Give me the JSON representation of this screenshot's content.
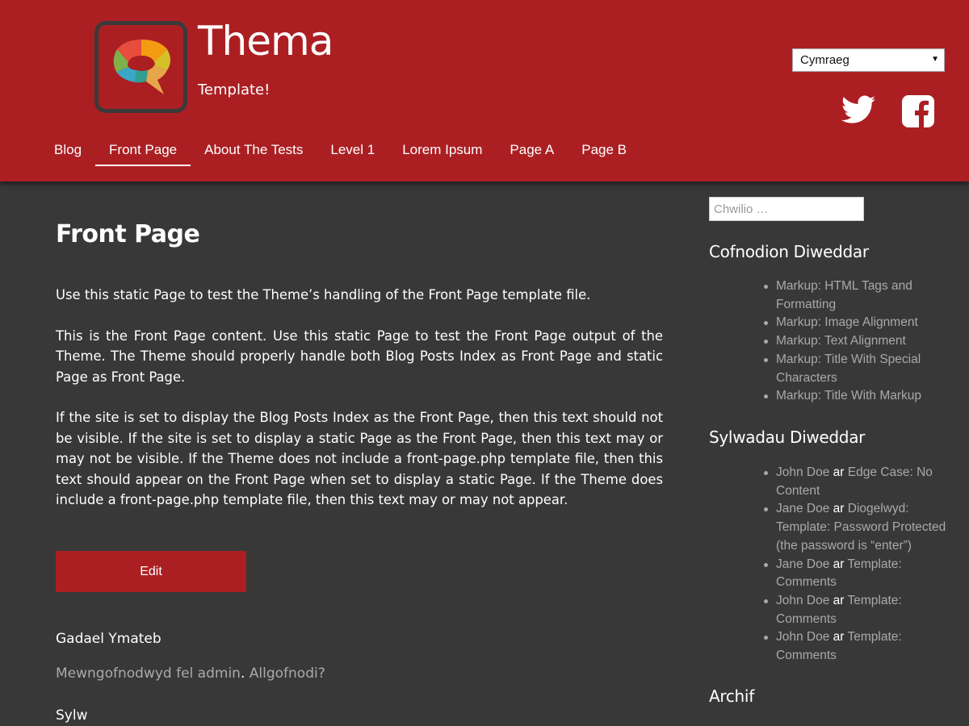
{
  "site": {
    "title": "Thema",
    "tagline": "Template!",
    "logo_icon": "speech-bubble-logo-icon"
  },
  "language": {
    "selected": "Cymraeg"
  },
  "social": [
    {
      "icon": "twitter-icon"
    },
    {
      "icon": "facebook-icon"
    }
  ],
  "nav": {
    "items": [
      {
        "label": "Blog"
      },
      {
        "label": "Front Page",
        "active": true
      },
      {
        "label": "About The Tests"
      },
      {
        "label": "Level 1"
      },
      {
        "label": "Lorem Ipsum"
      },
      {
        "label": "Page A"
      },
      {
        "label": "Page B"
      }
    ]
  },
  "main": {
    "title": "Front Page",
    "paragraphs": [
      "Use this static Page to test the Theme’s handling of the Front Page template file.",
      "This is the Front Page content. Use this static Page to test the Front Page output of the Theme. The Theme should properly handle both Blog Posts Index as Front Page and static Page as Front Page.",
      "If the site is set to display the Blog Posts Index as the Front Page, then this text should not be visible. If the site is set to display a static Page as the Front Page, then this text may or may not be visible. If the Theme does not include a front-page.php template file, then this text should appear on the Front Page when set to display a static Page. If the Theme does include a front-page.php template file, then this text may or may not appear."
    ],
    "edit_label": "Edit",
    "reply_title": "Gadael Ymateb",
    "logged_in_text": "Mewngofnodwyd fel admin",
    "logged_in_sep": ".",
    "logout_text": "Allgofnodi?",
    "comment_label": "Sylw"
  },
  "sidebar": {
    "search_placeholder": "Chwilio …",
    "recent_posts_title": "Cofnodion Diweddar",
    "recent_posts": [
      "Markup: HTML Tags and Formatting",
      "Markup: Image Alignment",
      "Markup: Text Alignment",
      "Markup: Title With Special Characters",
      "Markup: Title With Markup"
    ],
    "recent_comments_title": "Sylwadau Diweddar",
    "recent_comments": [
      {
        "author": "John Doe",
        "sep": "ar",
        "post": "Edge Case: No Content"
      },
      {
        "author": "Jane Doe",
        "sep": "ar",
        "post": "Diogelwyd: Template: Password Protected (the password is “enter”)"
      },
      {
        "author": "Jane Doe",
        "sep": "ar",
        "post": "Template: Comments"
      },
      {
        "author": "John Doe",
        "sep": "ar",
        "post": "Template: Comments"
      },
      {
        "author": "John Doe",
        "sep": "ar",
        "post": "Template: Comments"
      }
    ],
    "archives_title": "Archif"
  },
  "colors": {
    "header_bg": "#ab1f23",
    "body_bg": "#383838",
    "accent": "#ab1f23",
    "link_gray": "#a9a9a9"
  }
}
